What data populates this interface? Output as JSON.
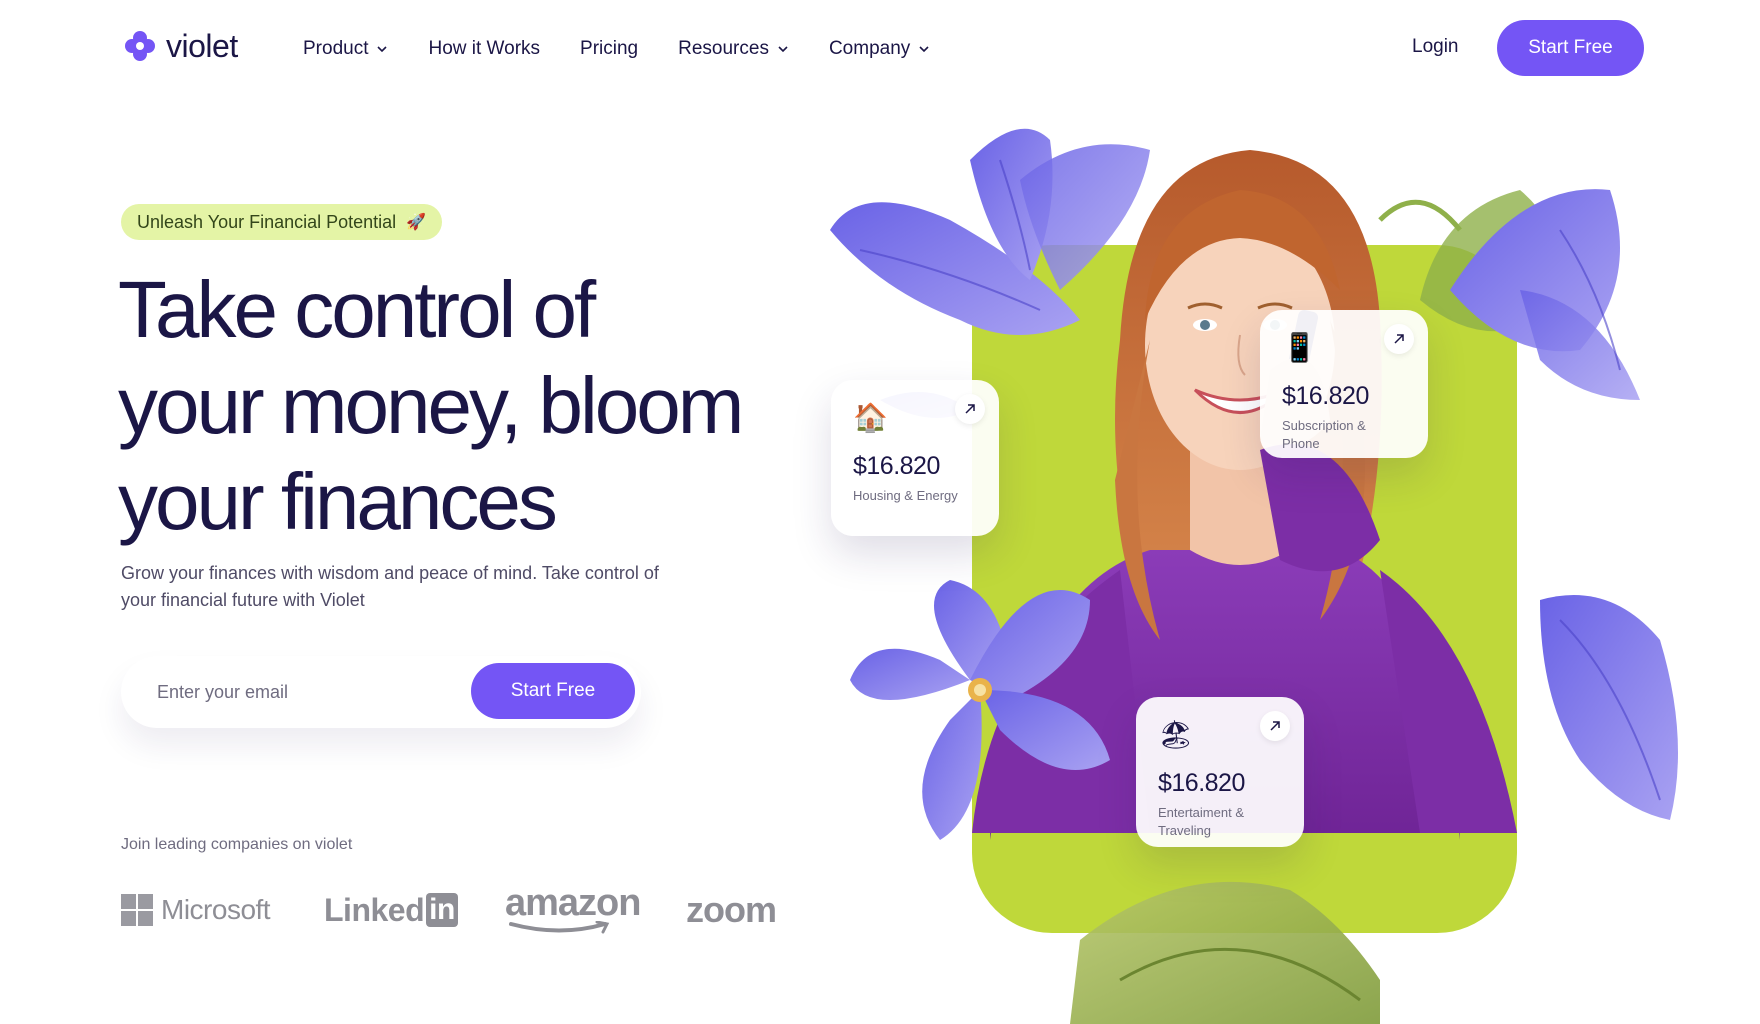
{
  "brand": {
    "name": "violet",
    "color": "#7455f5"
  },
  "nav": {
    "items": [
      {
        "label": "Product",
        "has_dropdown": true
      },
      {
        "label": "How it Works",
        "has_dropdown": false
      },
      {
        "label": "Pricing",
        "has_dropdown": false
      },
      {
        "label": "Resources",
        "has_dropdown": true
      },
      {
        "label": "Company",
        "has_dropdown": true
      }
    ],
    "login_label": "Login",
    "cta_label": "Start Free"
  },
  "hero": {
    "badge": "Unleash Your Financial Potential",
    "badge_icon": "rocket-icon",
    "headline": [
      "Take control of",
      "your money, bloom",
      "your finances"
    ],
    "subtext": "Grow your finances with wisdom and peace of mind. Take control of your financial future with Violet",
    "email_placeholder": "Enter your email",
    "cta_label": "Start Free",
    "join_text": "Join leading companies on violet",
    "companies": [
      "Microsoft",
      "Linked",
      "in",
      "amazon",
      "zoom"
    ]
  },
  "cards": [
    {
      "icon": "house-icon",
      "emoji": "🏠",
      "amount": "$16.820",
      "label": "Housing & Energy"
    },
    {
      "icon": "phone-icon",
      "emoji": "📱",
      "amount": "$16.820",
      "label": "Subscription & Phone"
    },
    {
      "icon": "beach-icon",
      "emoji": "🏖",
      "amount": "$16.820",
      "label": "Entertaiment & Traveling"
    }
  ],
  "colors": {
    "accent": "#7455f5",
    "badge_bg": "#e4f4a6",
    "panel_green": "#bfd83a",
    "heading": "#1b1646",
    "sweater": "#7d2fa8",
    "petal": "#7a6ee6"
  }
}
